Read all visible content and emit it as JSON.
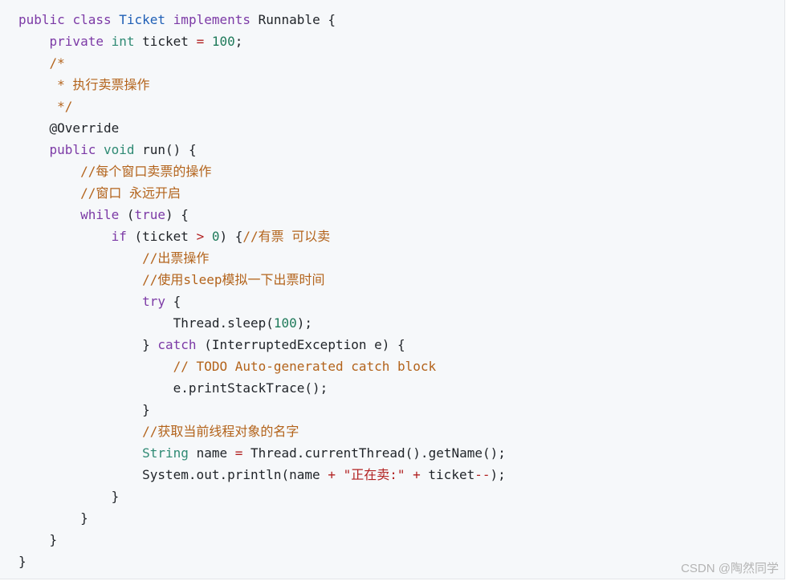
{
  "code": {
    "lines": [
      [
        [
          "kw",
          "public "
        ],
        [
          "kw",
          "class "
        ],
        [
          "cls",
          "Ticket "
        ],
        [
          "kw",
          "implements "
        ],
        [
          "plain",
          "Runnable {"
        ]
      ],
      [
        [
          "plain",
          "    "
        ],
        [
          "kw",
          "private "
        ],
        [
          "type",
          "int "
        ],
        [
          "plain",
          "ticket "
        ],
        [
          "op",
          "="
        ],
        [
          "plain",
          " "
        ],
        [
          "num",
          "100"
        ],
        [
          "plain",
          ";"
        ]
      ],
      [
        [
          "plain",
          "    "
        ],
        [
          "cm",
          "/*"
        ]
      ],
      [
        [
          "plain",
          "     "
        ],
        [
          "cm",
          "* 执行卖票操作"
        ]
      ],
      [
        [
          "plain",
          "     "
        ],
        [
          "cm",
          "*/"
        ]
      ],
      [
        [
          "plain",
          "    "
        ],
        [
          "plain",
          "@Override"
        ]
      ],
      [
        [
          "plain",
          "    "
        ],
        [
          "kw",
          "public "
        ],
        [
          "type",
          "void "
        ],
        [
          "plain",
          "run() {"
        ]
      ],
      [
        [
          "plain",
          "        "
        ],
        [
          "cm",
          "//每个窗口卖票的操作"
        ]
      ],
      [
        [
          "plain",
          "        "
        ],
        [
          "cm",
          "//窗口 永远开启"
        ]
      ],
      [
        [
          "plain",
          "        "
        ],
        [
          "kw",
          "while "
        ],
        [
          "plain",
          "("
        ],
        [
          "kw",
          "true"
        ],
        [
          "plain",
          ") {"
        ]
      ],
      [
        [
          "plain",
          "            "
        ],
        [
          "kw",
          "if "
        ],
        [
          "plain",
          "(ticket "
        ],
        [
          "op",
          ">"
        ],
        [
          "plain",
          " "
        ],
        [
          "num",
          "0"
        ],
        [
          "plain",
          ") {"
        ],
        [
          "cm",
          "//有票 可以卖"
        ]
      ],
      [
        [
          "plain",
          "                "
        ],
        [
          "cm",
          "//出票操作"
        ]
      ],
      [
        [
          "plain",
          "                "
        ],
        [
          "cm",
          "//使用sleep模拟一下出票时间"
        ]
      ],
      [
        [
          "plain",
          "                "
        ],
        [
          "kw",
          "try "
        ],
        [
          "plain",
          "{"
        ]
      ],
      [
        [
          "plain",
          "                    "
        ],
        [
          "plain",
          "Thread.sleep("
        ],
        [
          "num",
          "100"
        ],
        [
          "plain",
          ");"
        ]
      ],
      [
        [
          "plain",
          "                "
        ],
        [
          "plain",
          "} "
        ],
        [
          "kw",
          "catch "
        ],
        [
          "plain",
          "(InterruptedException e) {"
        ]
      ],
      [
        [
          "plain",
          "                    "
        ],
        [
          "cm",
          "// TODO Auto-generated catch block"
        ]
      ],
      [
        [
          "plain",
          "                    "
        ],
        [
          "plain",
          "e.printStackTrace();"
        ]
      ],
      [
        [
          "plain",
          "                "
        ],
        [
          "plain",
          "}"
        ]
      ],
      [
        [
          "plain",
          "                "
        ],
        [
          "cm",
          "//获取当前线程对象的名字"
        ]
      ],
      [
        [
          "plain",
          "                "
        ],
        [
          "type",
          "String "
        ],
        [
          "plain",
          "name "
        ],
        [
          "op",
          "="
        ],
        [
          "plain",
          " Thread.currentThread().getName();"
        ]
      ],
      [
        [
          "plain",
          "                "
        ],
        [
          "plain",
          "System.out.println(name "
        ],
        [
          "op",
          "+"
        ],
        [
          "plain",
          " "
        ],
        [
          "str",
          "\"正在卖:\""
        ],
        [
          "plain",
          " "
        ],
        [
          "op",
          "+"
        ],
        [
          "plain",
          " ticket"
        ],
        [
          "op",
          "--"
        ],
        [
          "plain",
          ");"
        ]
      ],
      [
        [
          "plain",
          "            "
        ],
        [
          "plain",
          "}"
        ]
      ],
      [
        [
          "plain",
          "        "
        ],
        [
          "plain",
          "}"
        ]
      ],
      [
        [
          "plain",
          "    "
        ],
        [
          "plain",
          "}"
        ]
      ],
      [
        [
          "plain",
          "}"
        ]
      ]
    ]
  },
  "watermark": "CSDN @陶然同学"
}
